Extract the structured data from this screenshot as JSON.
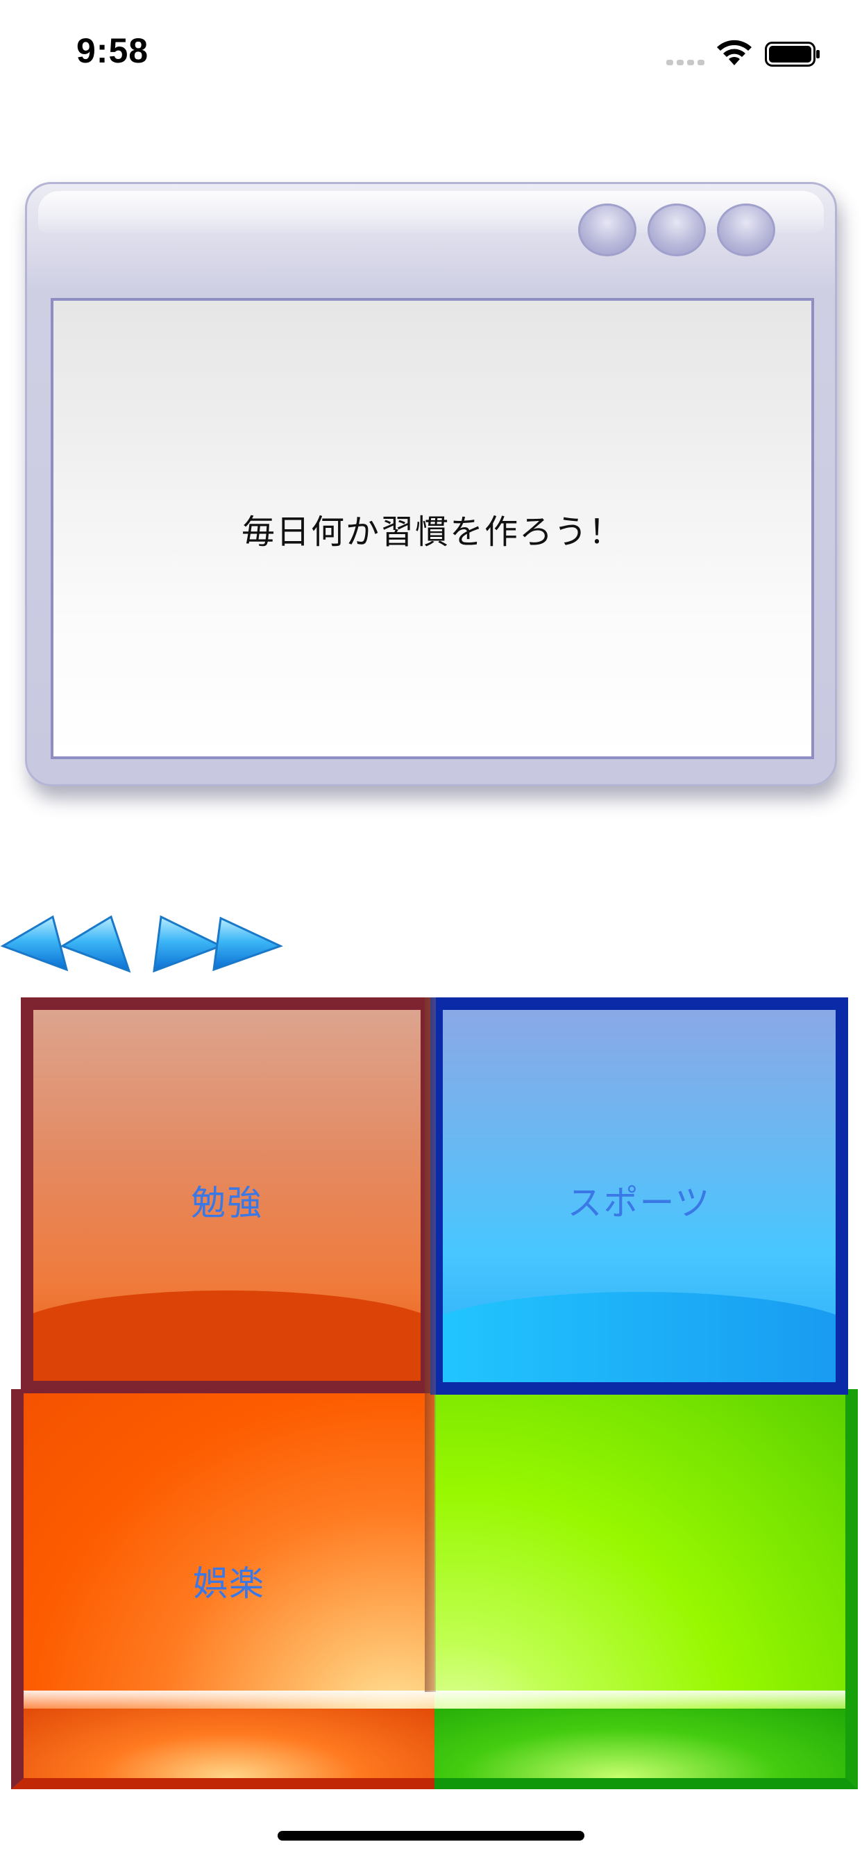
{
  "status_bar": {
    "time": "9:58"
  },
  "window": {
    "message": "毎日何か習慣を作ろう！"
  },
  "nav": {
    "prev_icon": "double-left-arrow-icon",
    "next_icon": "double-right-arrow-icon"
  },
  "categories": [
    {
      "label": "勉強",
      "color": "#e8774a"
    },
    {
      "label": "スポーツ",
      "color": "#48c6ff"
    },
    {
      "label": "娯楽",
      "color": "#fd5c00"
    },
    {
      "label": "",
      "color": "#98f800"
    }
  ],
  "colors": {
    "label_text": "#3a78e6"
  }
}
